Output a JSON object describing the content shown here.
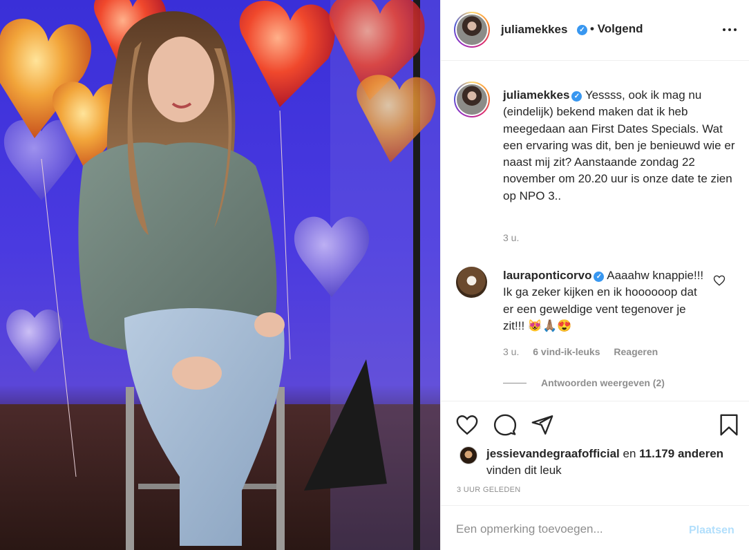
{
  "header": {
    "username": "juliamekkes",
    "follow_status": "• Volgend"
  },
  "caption": {
    "username": "juliamekkes",
    "text": "Yessss, ook ik mag nu (eindelijk) bekend maken dat ik heb meegedaan aan First Dates Specials. Wat een ervaring was dit, ben je benieuwd wie er naast mij zit? Aanstaande zondag 22 november om 20.20 uur is onze date te zien op NPO 3..",
    "time": "3 u."
  },
  "comment": {
    "username": "lauraponticorvo",
    "text": "Aaaahw knappie!!! Ik ga zeker kijken en ik hoooooop dat er een geweldige vent tegenover je zit!!! 😻🙏🏽😍",
    "time": "3 u.",
    "likes": "6 vind-ik-leuks",
    "reply_label": "Reageren",
    "view_replies": "Antwoorden weergeven (2)"
  },
  "likes": {
    "user": "jessievandegraafofficial",
    "connector": "en",
    "count": "11.179 anderen",
    "suffix": "vinden dit leuk"
  },
  "post_time": "3 UUR GELEDEN",
  "add_comment": {
    "placeholder": "Een opmerking toevoegen...",
    "post_label": "Plaatsen"
  },
  "icons": {
    "verified": "verified-badge-icon",
    "more": "more-options-icon",
    "like": "heart-icon",
    "comment": "comment-icon",
    "share": "paper-plane-icon",
    "save": "bookmark-icon"
  },
  "colors": {
    "verified": "#3897f0",
    "muted_text": "#8e8e8e",
    "post_button_disabled": "#b2dffc"
  }
}
